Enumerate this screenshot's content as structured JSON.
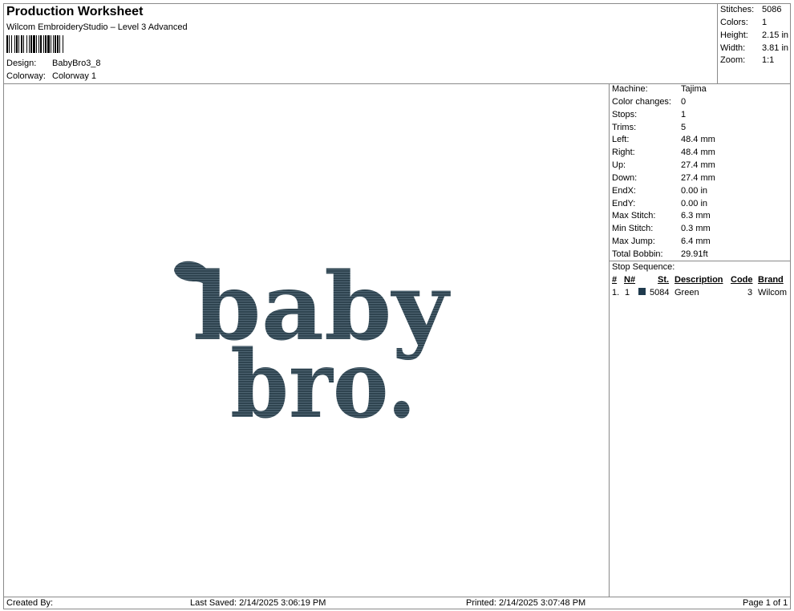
{
  "header": {
    "title": "Production Worksheet",
    "software": "Wilcom EmbroideryStudio – Level 3 Advanced",
    "design_label": "Design:",
    "design_value": "BabyBro3_8",
    "colorway_label": "Colorway:",
    "colorway_value": "Colorway 1"
  },
  "summary": [
    {
      "label": "Stitches:",
      "value": "5086"
    },
    {
      "label": "Colors:",
      "value": "1"
    },
    {
      "label": "Height:",
      "value": "2.15 in"
    },
    {
      "label": "Width:",
      "value": "3.81 in"
    },
    {
      "label": "Zoom:",
      "value": "1:1"
    }
  ],
  "design": {
    "line1": "baby",
    "line2": "bro.",
    "thread_color": "#2f4450"
  },
  "properties": [
    {
      "label": "Machine:",
      "value": "Tajima"
    },
    {
      "label": "Color changes:",
      "value": "0"
    },
    {
      "label": "Stops:",
      "value": "1"
    },
    {
      "label": "Trims:",
      "value": "5"
    },
    {
      "label": "Left:",
      "value": "48.4 mm"
    },
    {
      "label": "Right:",
      "value": "48.4 mm"
    },
    {
      "label": "Up:",
      "value": "27.4 mm"
    },
    {
      "label": "Down:",
      "value": "27.4 mm"
    },
    {
      "label": "EndX:",
      "value": "0.00 in"
    },
    {
      "label": "EndY:",
      "value": "0.00 in"
    },
    {
      "label": "Max Stitch:",
      "value": "6.3 mm"
    },
    {
      "label": "Min Stitch:",
      "value": "0.3 mm"
    },
    {
      "label": "Max Jump:",
      "value": "6.4 mm"
    },
    {
      "label": "Total Bobbin:",
      "value": "29.91ft"
    }
  ],
  "stop_sequence": {
    "title": "Stop Sequence:",
    "headers": {
      "num": "#",
      "n": "N#",
      "st": "St.",
      "description": "Description",
      "code": "Code",
      "brand": "Brand"
    },
    "rows": [
      {
        "num": "1.",
        "n": "1",
        "swatch": "#1f3a4d",
        "st": "5084",
        "description": "Green",
        "code": "3",
        "brand": "Wilcom"
      }
    ]
  },
  "footer": {
    "created_by": "Created By:",
    "last_saved": "Last Saved: 2/14/2025 3:06:19 PM",
    "printed": "Printed: 2/14/2025 3:07:48 PM",
    "page": "Page 1 of 1"
  }
}
